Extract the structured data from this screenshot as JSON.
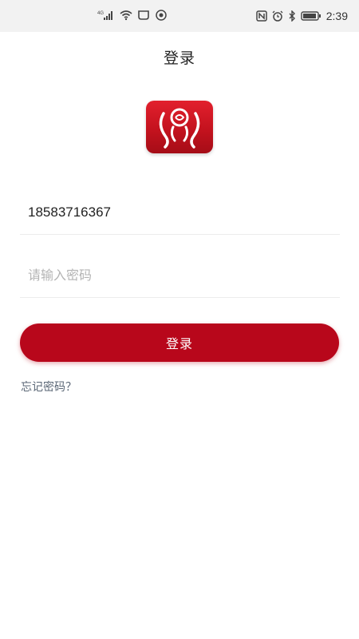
{
  "status_bar": {
    "network_label": "4G",
    "time": "2:39",
    "icons": [
      "signal-icon",
      "wifi-icon",
      "message-icon",
      "camera-icon",
      "nfc-icon",
      "alarm-icon",
      "bluetooth-icon",
      "battery-icon"
    ]
  },
  "header": {
    "title": "登录"
  },
  "app_logo": {
    "name": "app-logo",
    "accent": "#c4121e"
  },
  "form": {
    "phone_value": "18583716367",
    "password_placeholder": "请输入密码",
    "login_button_label": "登录",
    "forgot_password_label": "忘记密码？"
  },
  "colors": {
    "primary": "#b8071b",
    "link": "#5a6675",
    "divider": "#ececec"
  }
}
